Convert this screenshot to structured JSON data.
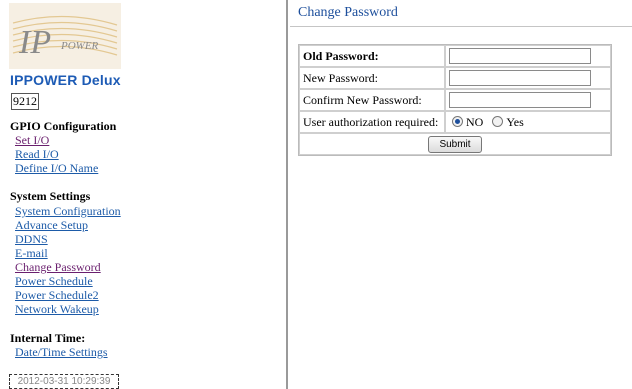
{
  "sidebar": {
    "brand": "IPPOWER Delux",
    "device_id": "9212",
    "gpio": {
      "title": "GPIO Configuration",
      "links": [
        "Set I/O",
        "Read I/O",
        "Define I/O Name"
      ]
    },
    "system": {
      "title": "System Settings",
      "links": [
        "System Configuration",
        "Advance Setup",
        "DDNS",
        "E-mail",
        "Change Password",
        "Power Schedule",
        "Power Schedule2",
        "Network Wakeup"
      ]
    },
    "internal_time": {
      "title": "Internal Time:",
      "link": "Date/Time Settings",
      "clock": "2012-03-31 10:29:39"
    }
  },
  "main": {
    "title": "Change Password",
    "form": {
      "old_password_label": "Old Password:",
      "new_password_label": "New Password:",
      "confirm_password_label": "Confirm New Password:",
      "auth_label": "User authorization required:",
      "auth_options": [
        "NO",
        "Yes"
      ],
      "auth_selected": "NO",
      "submit_label": "Submit"
    }
  },
  "colors": {
    "link": "#1d5ba8",
    "visited": "#6a1f6e",
    "brand": "#1d5bb5"
  }
}
